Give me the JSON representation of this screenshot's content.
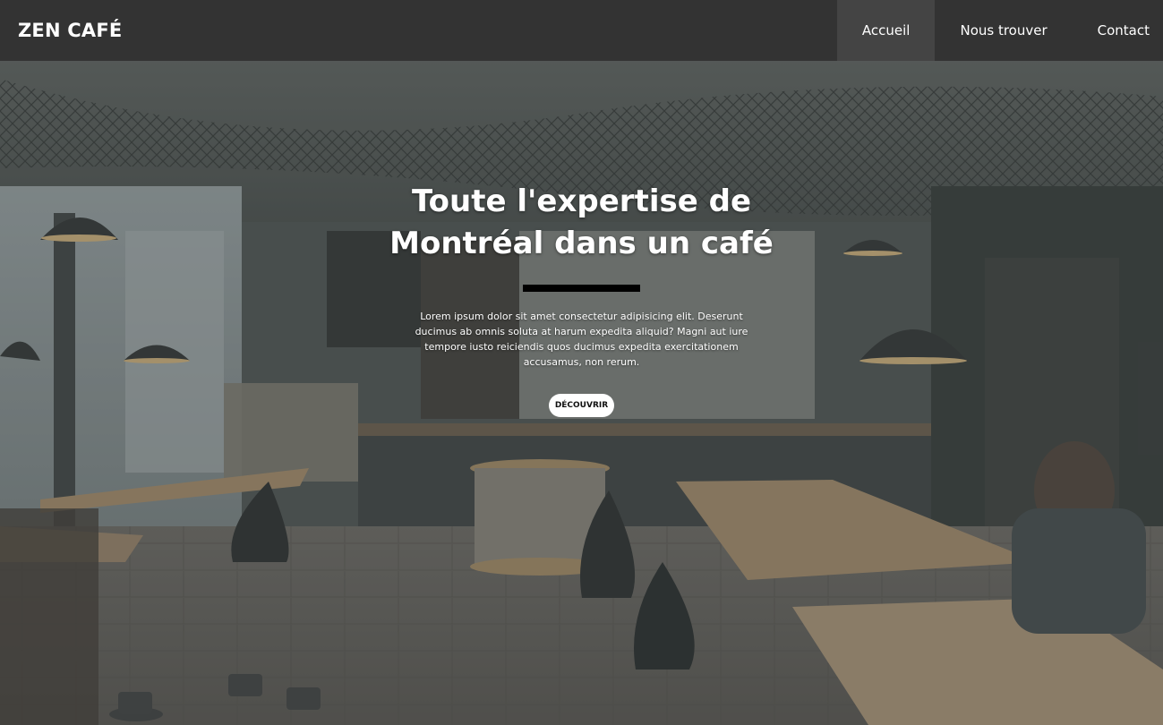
{
  "brand": "ZEN CAFÉ",
  "nav": {
    "items": [
      "Accueil",
      "Nous trouver",
      "Contact"
    ],
    "active": "Accueil"
  },
  "hero": {
    "title": "Toute l'expertise de Montréal dans un café",
    "text": "Lorem ipsum dolor sit amet consectetur adipisicing elit. Deserunt ducimus ab omnis soluta at harum expedita aliquid? Magni aut iure tempore iusto reiciendis quos ducimus expedita exercitationem accusamus, non rerum.",
    "button": "DÉCOUVRIR"
  },
  "colors": {
    "navbar": "#333333",
    "nav_active": "#444444",
    "divider": "#000000",
    "button_bg": "#ffffff"
  }
}
